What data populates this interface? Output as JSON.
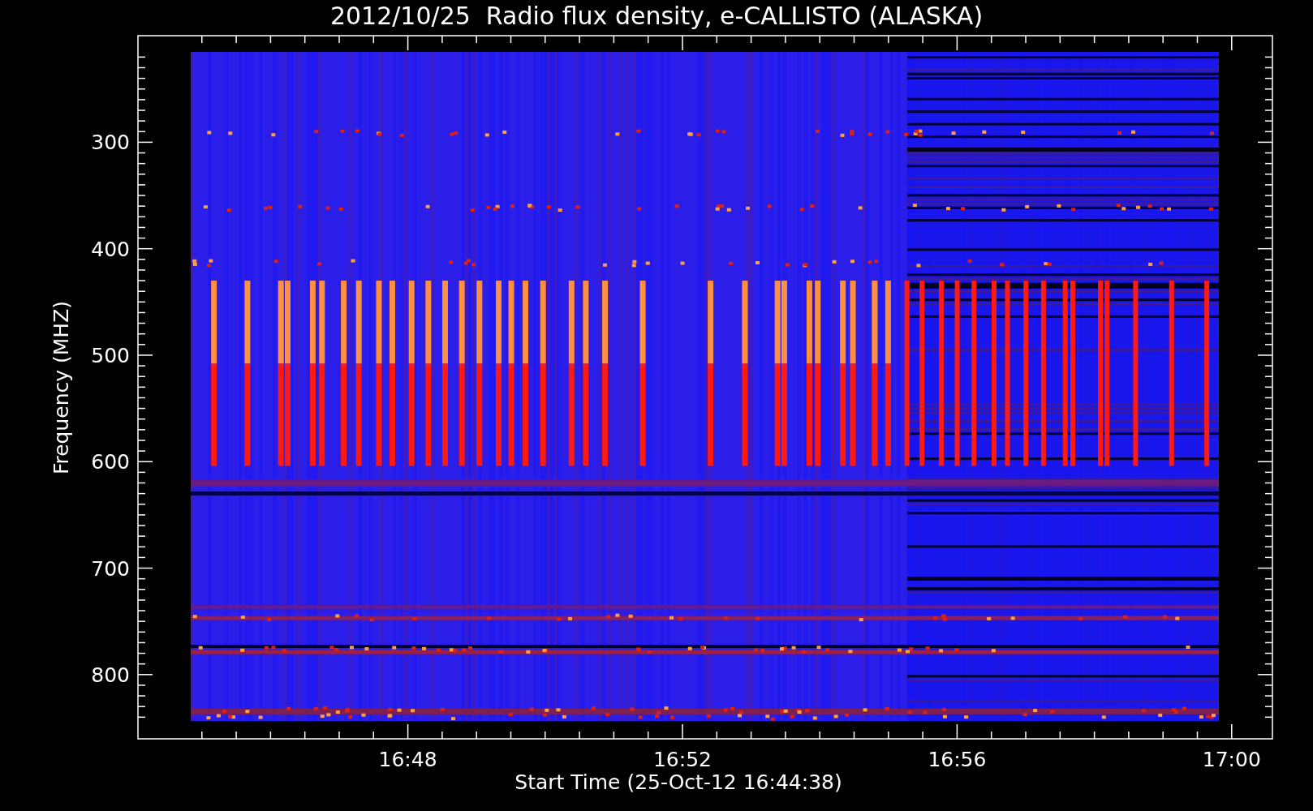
{
  "title": "2012/10/25  Radio flux density, e-CALLISTO (ALASKA)",
  "y_axis": {
    "label": "Frequency (MHZ)",
    "ticks": [
      "300",
      "400",
      "500",
      "600",
      "700",
      "800"
    ]
  },
  "x_axis": {
    "label": "Start Time (25-Oct-12 16:44:38)",
    "ticks": [
      "16:48",
      "16:52",
      "16:56",
      "17:00"
    ]
  }
}
